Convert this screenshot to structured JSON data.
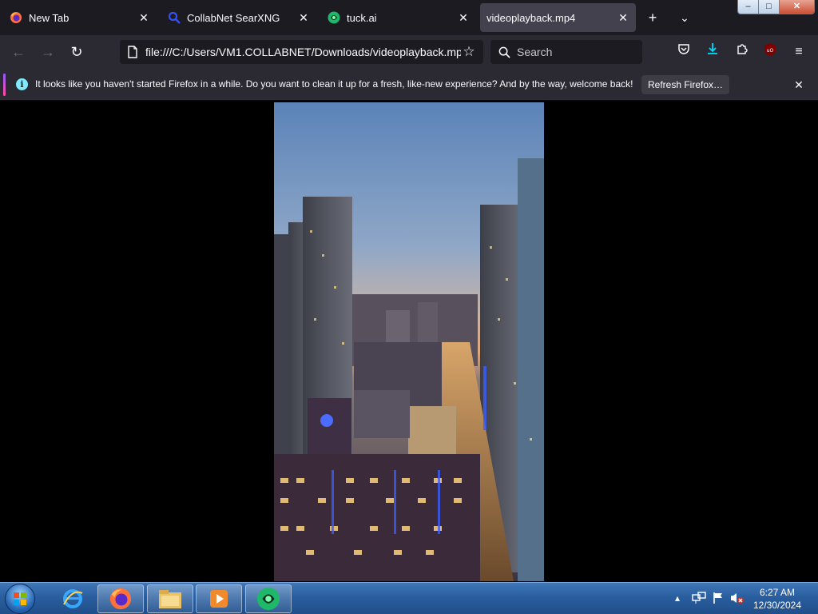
{
  "tabs": [
    {
      "title": "New Tab",
      "icon": "firefox-icon",
      "active": false
    },
    {
      "title": "CollabNet SearXNG",
      "icon": "magnifier-icon",
      "active": false
    },
    {
      "title": "tuck.ai",
      "icon": "tuck-icon",
      "active": false
    },
    {
      "title": "videoplayback.mp4",
      "icon": "none",
      "active": true
    }
  ],
  "tabstrip": {
    "new_tab_icon": "plus-icon",
    "list_all_tabs_icon": "chevron-down-icon"
  },
  "window_controls": {
    "minimize": "–",
    "maximize": "□",
    "close": "✕"
  },
  "navbar": {
    "back_icon": "back-arrow-icon",
    "forward_icon": "forward-arrow-icon",
    "reload_icon": "reload-icon",
    "url": "file:///C:/Users/VM1.COLLABNET/Downloads/videoplayback.mp4",
    "bookmark_icon": "star-icon",
    "search_placeholder": "Search",
    "tools": [
      "pocket-icon",
      "downloads-icon",
      "extensions-icon",
      "ublock-icon",
      "menu-icon"
    ]
  },
  "notification": {
    "message": "It looks like you haven't started Firefox in a while. Do you want to clean it up for a fresh, like-new experience? And by the way, welcome back!",
    "button_label": "Refresh Firefox…",
    "colors": {
      "accent_start": "#9059ff",
      "accent_end": "#ff4aa2",
      "info": "#80ebff"
    }
  },
  "video": {
    "description_icon": "city-night-video-frame"
  },
  "taskbar": {
    "items": [
      "start-orb",
      "internet-explorer-icon",
      "firefox-icon",
      "file-explorer-icon",
      "media-player-icon",
      "tuck-app-icon"
    ],
    "clock_time": "6:27 AM",
    "clock_date": "12/30/2024"
  },
  "colors": {
    "toolbar": "#2b2a33",
    "tabstrip": "#1c1b22",
    "active_tab": "#42414d",
    "text": "#fbfbfe",
    "taskbar": "#2a5e9f"
  }
}
